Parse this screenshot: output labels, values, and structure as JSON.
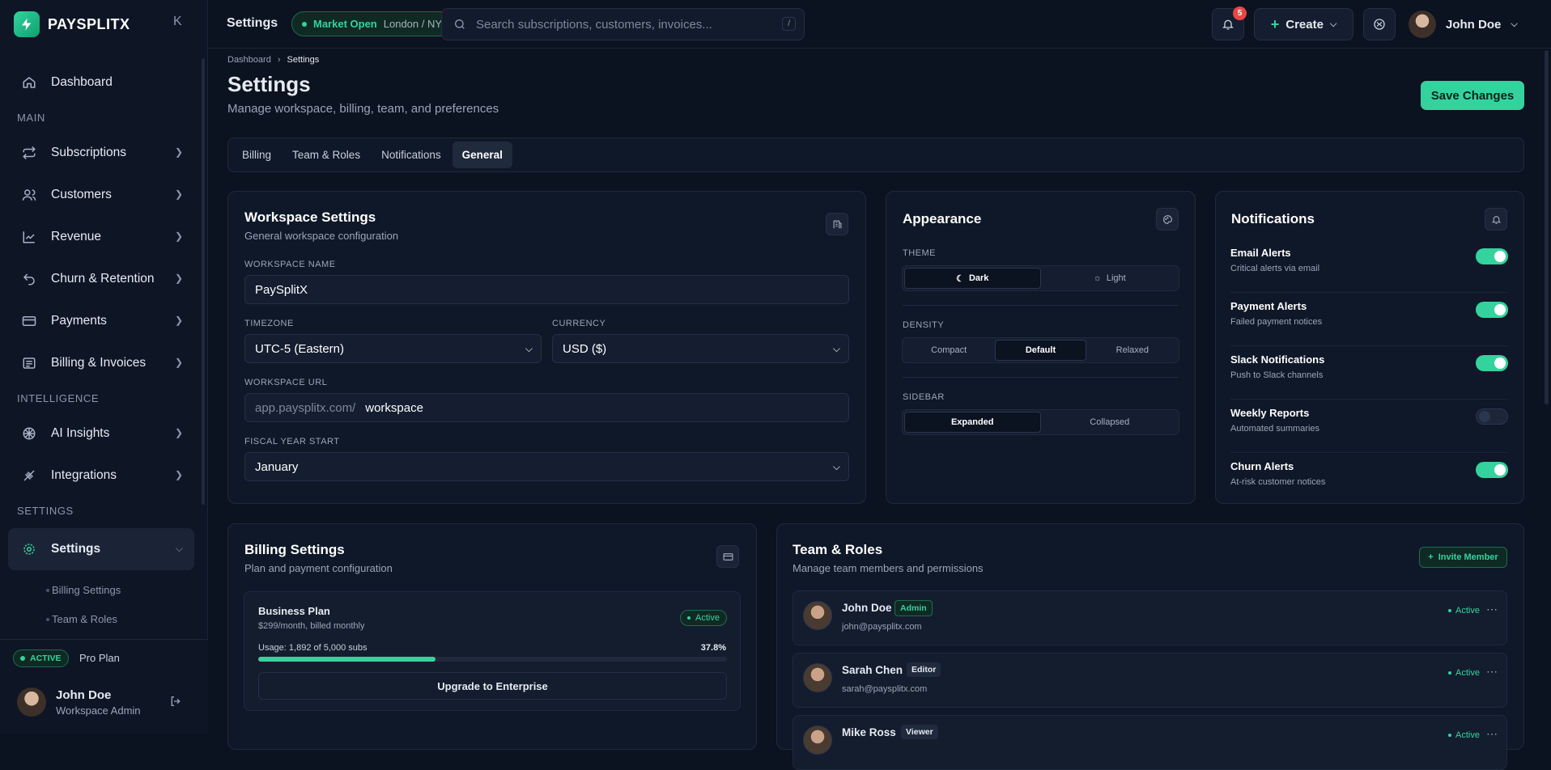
{
  "brand": {
    "name": "PAYSPLITX",
    "collapse_glyph": "K"
  },
  "nav": {
    "dashboard": "Dashboard",
    "section_main": "MAIN",
    "subscriptions": "Subscriptions",
    "customers": "Customers",
    "revenue": "Revenue",
    "churn": "Churn & Retention",
    "payments": "Payments",
    "billing": "Billing & Invoices",
    "section_intel": "INTELLIGENCE",
    "ai": "AI Insights",
    "integrations": "Integrations",
    "section_settings": "SETTINGS",
    "settings": "Settings",
    "sub_billing": "Billing Settings",
    "sub_team": "Team & Roles"
  },
  "sidebar_footer": {
    "badge": "ACTIVE",
    "plan": "Pro Plan",
    "user_name": "John Doe",
    "user_role": "Workspace Admin"
  },
  "topbar": {
    "title": "Settings",
    "market_status": "Market Open",
    "market_zones": "London / NY",
    "search_placeholder": "Search subscriptions, customers, invoices...",
    "search_shortcut": "/",
    "notif_count": "5",
    "create_label": "Create",
    "user_name": "John Doe"
  },
  "breadcrumb": {
    "root": "Dashboard",
    "current": "Settings"
  },
  "page": {
    "title": "Settings",
    "subtitle": "Manage workspace, billing, team, and preferences",
    "save_label": "Save Changes"
  },
  "tabs": [
    "Billing",
    "Team & Roles",
    "Notifications",
    "General"
  ],
  "workspace": {
    "title": "Workspace Settings",
    "subtitle": "General workspace configuration",
    "name_label": "WORKSPACE NAME",
    "name_value": "PaySplitX",
    "tz_label": "TIMEZONE",
    "tz_value": "UTC-5 (Eastern)",
    "cur_label": "CURRENCY",
    "cur_value": "USD ($)",
    "url_label": "WORKSPACE URL",
    "url_prefix": "app.paysplitx.com/",
    "url_value": "workspace",
    "fy_label": "FISCAL YEAR START",
    "fy_value": "January"
  },
  "appearance": {
    "title": "Appearance",
    "theme_label": "THEME",
    "theme_dark": "Dark",
    "theme_light": "Light",
    "density_label": "DENSITY",
    "density_compact": "Compact",
    "density_default": "Default",
    "density_relaxed": "Relaxed",
    "sidebar_label": "SIDEBAR",
    "sidebar_expanded": "Expanded",
    "sidebar_collapsed": "Collapsed"
  },
  "notifications": {
    "title": "Notifications",
    "items": [
      {
        "title": "Email Alerts",
        "desc": "Critical alerts via email",
        "on": true
      },
      {
        "title": "Payment Alerts",
        "desc": "Failed payment notices",
        "on": true
      },
      {
        "title": "Slack Notifications",
        "desc": "Push to Slack channels",
        "on": true
      },
      {
        "title": "Weekly Reports",
        "desc": "Automated summaries",
        "on": false
      },
      {
        "title": "Churn Alerts",
        "desc": "At-risk customer notices",
        "on": true
      }
    ]
  },
  "billing": {
    "title": "Billing Settings",
    "subtitle": "Plan and payment configuration",
    "plan_name": "Business Plan",
    "plan_price": "$299/month, billed monthly",
    "plan_status": "Active",
    "usage_text": "Usage: 1,892 of 5,000 subs",
    "usage_pct": "37.8%",
    "usage_fraction": 0.378,
    "upgrade_label": "Upgrade to Enterprise"
  },
  "team": {
    "title": "Team & Roles",
    "subtitle": "Manage team members and permissions",
    "invite_label": "Invite Member",
    "members": [
      {
        "name": "John Doe",
        "role": "Admin",
        "email": "john@paysplitx.com",
        "status": "Active"
      },
      {
        "name": "Sarah Chen",
        "role": "Editor",
        "email": "sarah@paysplitx.com",
        "status": "Active"
      },
      {
        "name": "Mike Ross",
        "role": "Viewer",
        "email": "",
        "status": "Active"
      }
    ]
  },
  "colors": {
    "accent": "#34d39e",
    "bg": "#0b1220",
    "card": "#0f1828",
    "danger": "#ef4444"
  }
}
